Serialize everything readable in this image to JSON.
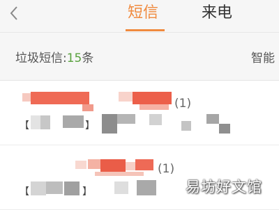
{
  "header": {
    "tabs": [
      {
        "label": "短信",
        "active": true
      },
      {
        "label": "来电",
        "active": false
      }
    ],
    "accent_color": "#f08a3e",
    "back_icon": "chevron-left-icon"
  },
  "spam": {
    "label_prefix": "垃圾短信:",
    "count": "15",
    "label_suffix": "条",
    "count_color": "#5aa23f",
    "action_label": "智能"
  },
  "messages": [
    {
      "count_label": "(1)",
      "bracket_open": "【",
      "bracket_close": "】"
    },
    {
      "count_label": "(1)",
      "bracket_open": "【",
      "bracket_close": "】"
    }
  ],
  "watermark": "易坊好文馆"
}
